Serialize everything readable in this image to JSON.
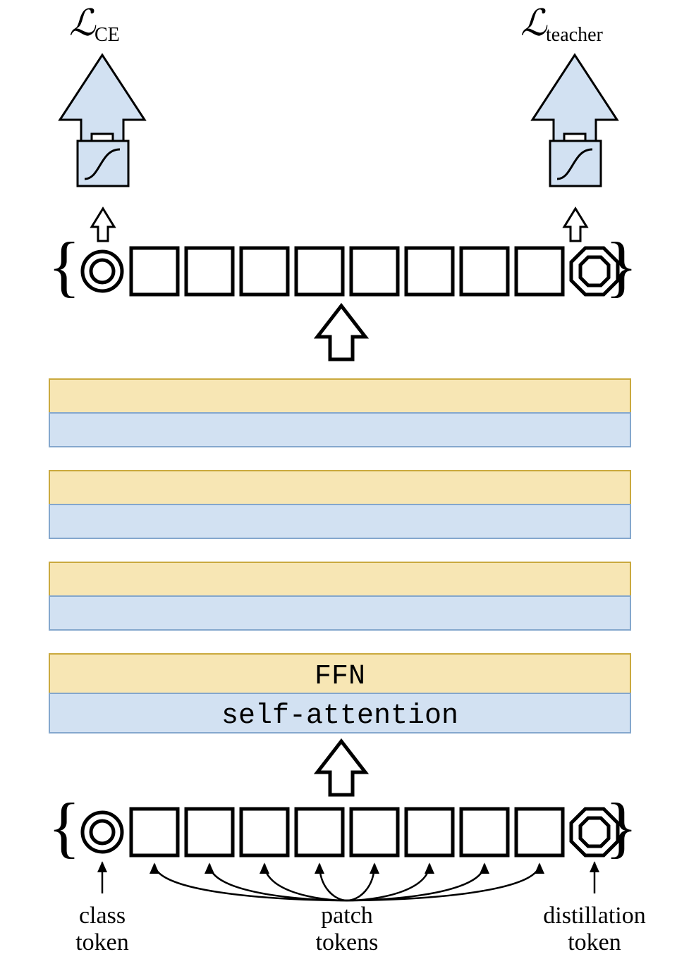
{
  "losses": {
    "left": {
      "symbol": "ℒ",
      "sub": "CE"
    },
    "right": {
      "symbol": "ℒ",
      "sub": "teacher"
    }
  },
  "layers": {
    "ffn_label": "FFN",
    "sa_label": "self-attention",
    "colors": {
      "ffn": "#f7e6b4",
      "ffn_stroke": "#caa93e",
      "sa": "#d2e1f2",
      "sa_stroke": "#84a7cd"
    }
  },
  "labels": {
    "class": {
      "l1": "class",
      "l2": "token"
    },
    "patch": {
      "l1": "patch",
      "l2": "tokens"
    },
    "distil": {
      "l1": "distillation",
      "l2": "token"
    }
  },
  "tokens": {
    "num_patches": 8
  },
  "arrow_fill": "#d2e1f2"
}
